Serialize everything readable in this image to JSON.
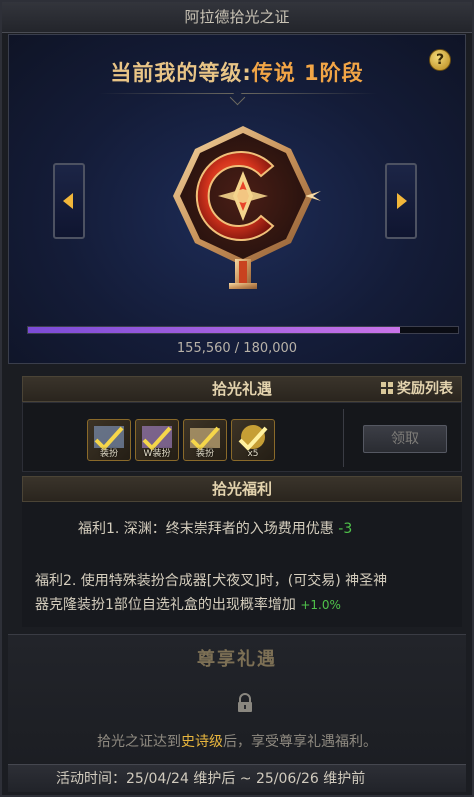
{
  "window": {
    "title": "阿拉德拾光之证"
  },
  "rank": {
    "label": "当前我的等级:",
    "value": "传说 1阶段",
    "progress_current": 155560,
    "progress_max": 180000,
    "progress_fraction": 0.864,
    "progress_text": "155,560 / 180,000"
  },
  "reward_section": {
    "title": "拾光礼遇",
    "list_link": "奖励列表",
    "items": [
      {
        "label": "装扮",
        "icon": "costume-item-icon"
      },
      {
        "label": "W装扮",
        "icon": "weapon-costume-icon"
      },
      {
        "label": "装扮",
        "icon": "costume-box-icon"
      },
      {
        "label": "x5",
        "icon": "gold-token-icon"
      }
    ],
    "claim_button": "领取"
  },
  "benefit_section": {
    "title": "拾光福利",
    "benefit1_text": "福利1. 深渊：终末崇拜者的入场费用优惠",
    "benefit1_value": "-3",
    "benefit2_line1": "福利2. 使用特殊装扮合成器[犬夜叉]时，(可交易) 神圣神",
    "benefit2_line2": "器克隆装扮1部位自选礼盒的出现概率增加",
    "benefit2_value": "+1.0%"
  },
  "vip_section": {
    "title": "尊享礼遇",
    "desc_prefix": "拾光之证达到",
    "desc_highlight": "史诗级",
    "desc_suffix": "后，享受尊享礼遇福利。"
  },
  "footer": {
    "activity_time": "活动时间：25/04/24 维护后 ~ 25/06/26 维护前"
  },
  "colors": {
    "accent_gold": "#e8c486",
    "progress_purple": "#c874e8",
    "benefit_green": "#4fc24a",
    "highlight_yellow": "#e8b63e"
  }
}
